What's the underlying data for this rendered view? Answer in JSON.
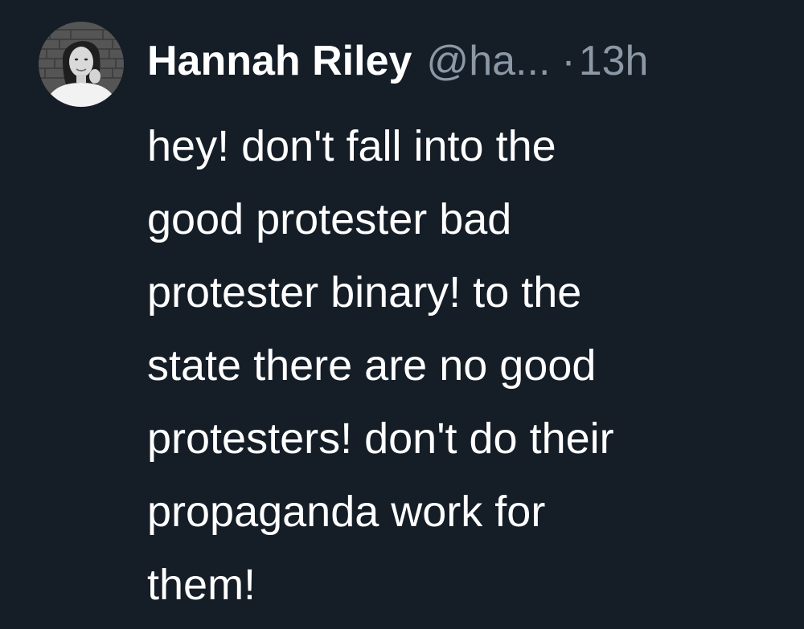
{
  "tweet": {
    "display_name": "Hannah Riley",
    "handle": "@ha...",
    "separator": "·",
    "timestamp": "13h",
    "avatar_icon": "profile-photo",
    "body_lines": [
      "hey! don't fall into the",
      "good protester bad",
      "protester binary! to the",
      "state there are no good",
      "protesters! don't do their",
      "propaganda work for",
      "them!"
    ]
  },
  "colors": {
    "background": "#151d27",
    "primary_text": "#ffffff",
    "secondary_text": "#8b98a5"
  }
}
